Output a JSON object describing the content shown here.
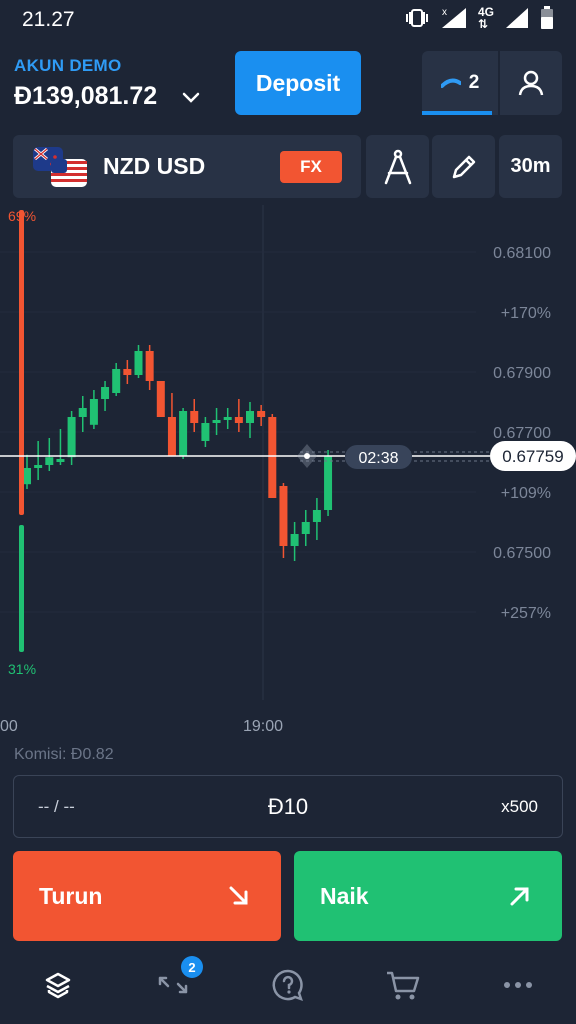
{
  "status_bar": {
    "time": "21.27",
    "network": "4G"
  },
  "header": {
    "account_label": "AKUN DEMO",
    "balance": "Đ139,081.72",
    "deposit_label": "Deposit",
    "open_trades_count": "2"
  },
  "asset": {
    "name": "NZD USD",
    "badge": "FX",
    "timeframe": "30m"
  },
  "chart_data": {
    "type": "candlestick",
    "sentiment_top": "69%",
    "sentiment_bottom": "31%",
    "y_ticks": [
      "0.68100",
      "+170%",
      "0.67900",
      "0.67700",
      "+109%",
      "0.67500",
      "+257%"
    ],
    "x_ticks": [
      "00",
      "19:00"
    ],
    "current_price": "0.67759",
    "countdown": "02:38",
    "ylim": [
      0.6745,
      0.6823
    ],
    "candles": [
      [
        0.67713,
        0.67762,
        0.67705,
        0.6774
      ],
      [
        0.6774,
        0.67785,
        0.6772,
        0.67745
      ],
      [
        0.67745,
        0.6779,
        0.67735,
        0.67758
      ],
      [
        0.6775,
        0.67805,
        0.67745,
        0.67755
      ],
      [
        0.67758,
        0.67835,
        0.67745,
        0.67825
      ],
      [
        0.67825,
        0.6786,
        0.678,
        0.6784
      ],
      [
        0.67812,
        0.6787,
        0.67805,
        0.67855
      ],
      [
        0.67855,
        0.67885,
        0.67835,
        0.67875
      ],
      [
        0.67865,
        0.67915,
        0.6786,
        0.67905
      ],
      [
        0.67905,
        0.6792,
        0.6788,
        0.67895
      ],
      [
        0.67895,
        0.67945,
        0.6789,
        0.67935
      ],
      [
        0.67935,
        0.67945,
        0.6787,
        0.67885
      ],
      [
        0.67885,
        0.6787,
        0.67825,
        0.67825
      ],
      [
        0.67825,
        0.67865,
        0.6776,
        0.6776
      ],
      [
        0.6776,
        0.6784,
        0.67755,
        0.67835
      ],
      [
        0.67835,
        0.67855,
        0.678,
        0.67815
      ],
      [
        0.67785,
        0.67825,
        0.67775,
        0.67815
      ],
      [
        0.67815,
        0.6784,
        0.67795,
        0.6782
      ],
      [
        0.6782,
        0.6784,
        0.67805,
        0.67825
      ],
      [
        0.67825,
        0.67855,
        0.678,
        0.67815
      ],
      [
        0.67815,
        0.6785,
        0.6779,
        0.67835
      ],
      [
        0.67835,
        0.67845,
        0.6781,
        0.67825
      ],
      [
        0.67825,
        0.6783,
        0.6769,
        0.6769
      ],
      [
        0.6771,
        0.67715,
        0.6759,
        0.6761
      ],
      [
        0.6761,
        0.6765,
        0.67585,
        0.6763
      ],
      [
        0.6763,
        0.6767,
        0.6761,
        0.6765
      ],
      [
        0.6765,
        0.6769,
        0.6762,
        0.6767
      ],
      [
        0.6767,
        0.6777,
        0.6766,
        0.67759
      ]
    ]
  },
  "trade": {
    "commission": "Komisi: Đ0.82",
    "timer_placeholder": "-- / --",
    "amount": "Đ10",
    "multiplier": "x500",
    "down_label": "Turun",
    "up_label": "Naik"
  },
  "nav": {
    "badge_count": "2"
  },
  "colors": {
    "up": "#20c173",
    "down": "#f25532",
    "accent": "#1a8ff0",
    "bg": "#1d2535",
    "panel": "#283245"
  }
}
